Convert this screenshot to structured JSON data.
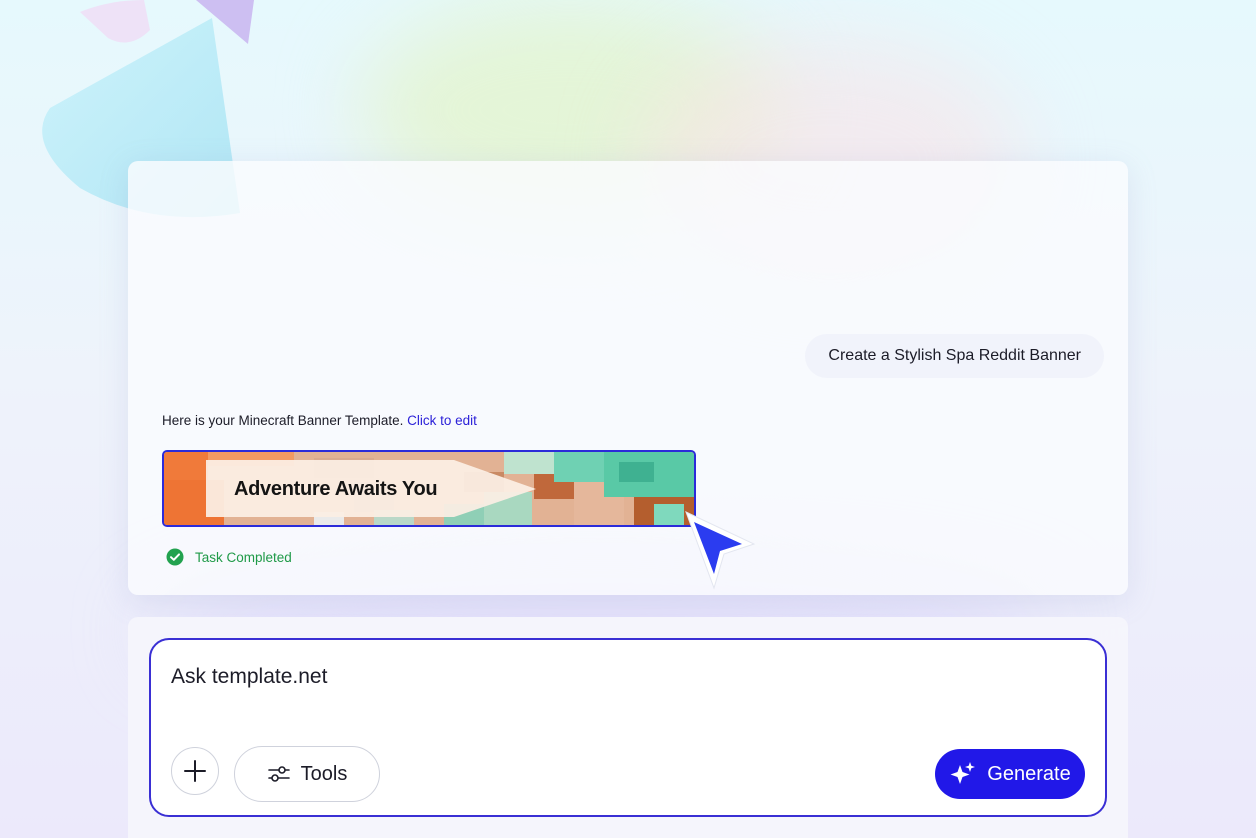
{
  "chat": {
    "user_message": "Create a Stylish Spa Reddit Banner",
    "assistant_message": "Here is your Minecraft Banner Template.",
    "edit_link": "Click to edit",
    "banner_title": "Adventure Awaits You",
    "status": "Task Completed"
  },
  "composer": {
    "prompt": "Ask template.net",
    "tools_label": "Tools",
    "generate_label": "Generate"
  },
  "icons": {
    "status": "check-circle-icon",
    "add": "plus-icon",
    "tools": "sliders-icon",
    "generate": "sparkles-icon",
    "cursor": "pointer-cursor-icon"
  },
  "colors": {
    "accent": "#2118e8",
    "border_accent": "#3a2fd4",
    "link": "#2a1fd8",
    "success": "#1f9a48"
  }
}
